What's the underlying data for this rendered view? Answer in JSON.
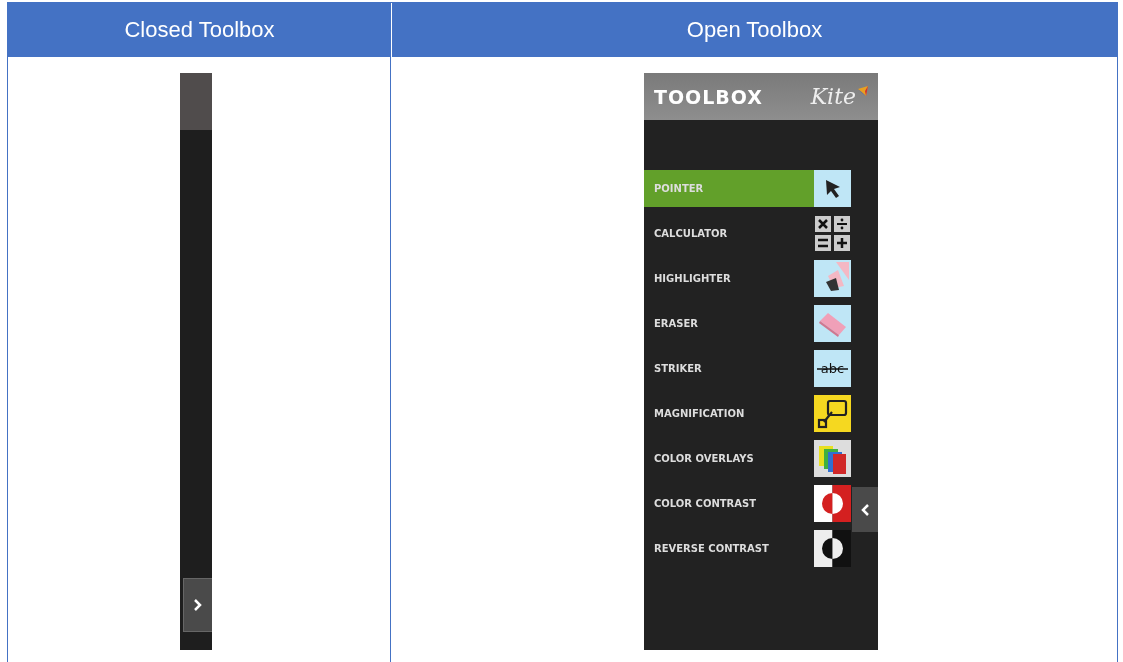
{
  "table": {
    "columns": [
      {
        "heading": "Closed Toolbox"
      },
      {
        "heading": "Open Toolbox"
      }
    ]
  },
  "open_toolbox": {
    "title": "TOOLBOX",
    "logo": "Kite",
    "tools": [
      {
        "label": "POINTER",
        "kind": "pointer",
        "selected": true
      },
      {
        "label": "CALCULATOR",
        "kind": "calculator",
        "selected": false
      },
      {
        "label": "HIGHLIGHTER",
        "kind": "highlighter",
        "selected": false
      },
      {
        "label": "ERASER",
        "kind": "eraser",
        "selected": false
      },
      {
        "label": "STRIKER",
        "kind": "striker",
        "selected": false,
        "icon_text": "abc"
      },
      {
        "label": "MAGNIFICATION",
        "kind": "magnification",
        "selected": false
      },
      {
        "label": "COLOR OVERLAYS",
        "kind": "overlays",
        "selected": false
      },
      {
        "label": "COLOR CONTRAST",
        "kind": "color_contrast",
        "selected": false
      },
      {
        "label": "REVERSE CONTRAST",
        "kind": "reverse_contrast",
        "selected": false
      }
    ]
  }
}
